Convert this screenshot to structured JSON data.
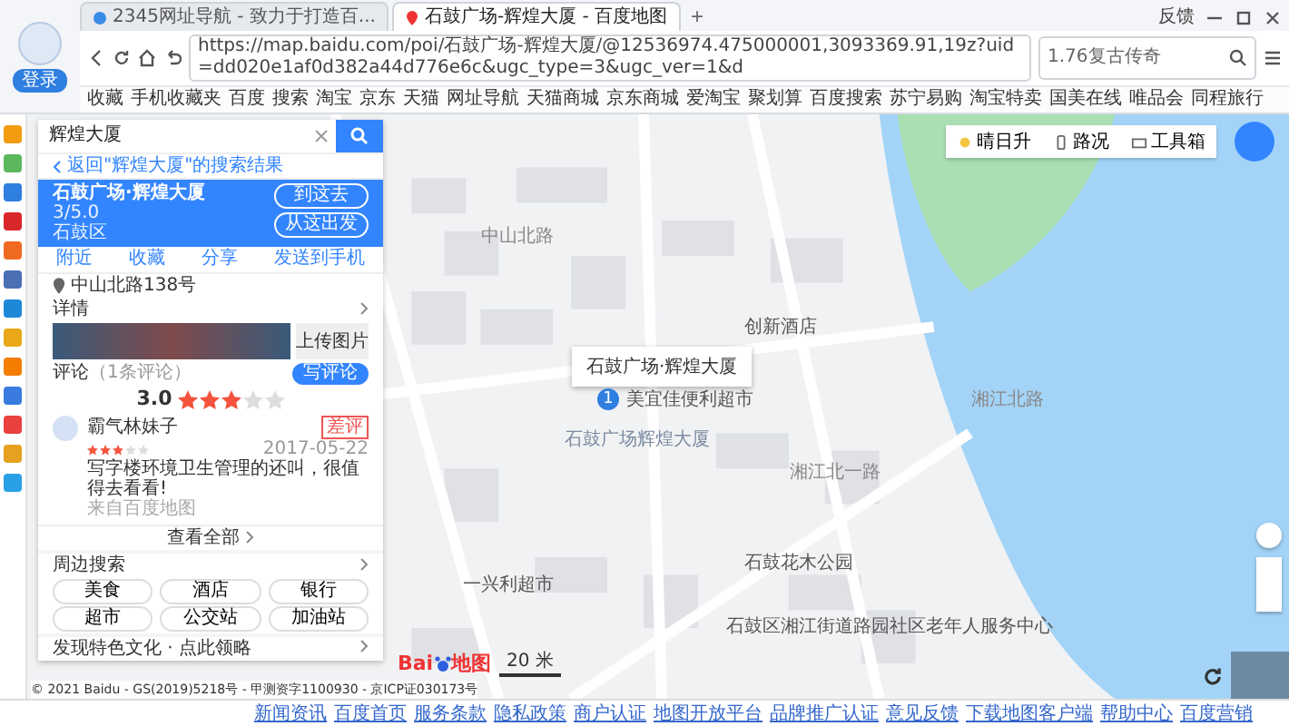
{
  "browser": {
    "login": "登录",
    "tabs": [
      {
        "title": "2345网址导航 - 致力于打造百...",
        "selected": false
      },
      {
        "title": "石鼓广场-辉煌大厦 - 百度地图",
        "selected": true
      }
    ],
    "new_tab": "+",
    "feedback": "反馈",
    "url": "https://map.baidu.com/poi/石鼓广场-辉煌大厦/@12536974.475000001,3093369.91,19z?uid=dd020e1af0d382a44d776e6c&ugc_type=3&ugc_ver=1&d",
    "search": "1.76复古传奇",
    "bookmarks": [
      "收藏",
      "手机收藏夹",
      "百度",
      "搜索",
      "淘宝",
      "京东",
      "天猫",
      "网址导航",
      "天猫商城",
      "京东商城",
      "爱淘宝",
      "聚划算",
      "百度搜索",
      "苏宁易购",
      "淘宝特卖",
      "国美在线",
      "唯品会",
      "同程旅行"
    ]
  },
  "panel": {
    "search": {
      "value": "辉煌大厦"
    },
    "back": "返回\"辉煌大厦\"的搜索结果",
    "place": {
      "name": "石鼓广场·辉煌大厦",
      "score": "3/5.0",
      "district": "石鼓区",
      "buttons": [
        "到这去",
        "从这出发"
      ]
    },
    "actions": [
      "附近",
      "收藏",
      "分享",
      "发送到手机"
    ],
    "address": "中山北路138号",
    "details": "详情",
    "upload": "上传图片",
    "comments": {
      "label": "评论",
      "count": "（1条评论）",
      "write": "写评论"
    },
    "rating": {
      "score": "3.0",
      "stars": 3
    },
    "review": {
      "user": "霸气林妹子",
      "stars": 3,
      "badge": "差评",
      "date": "2017-05-22",
      "text": "写字楼环境卫生管理的还叫，很值得去看看!",
      "source": "来自百度地图"
    },
    "view_all": "查看全部",
    "nearby": {
      "title": "周边搜索",
      "chips": [
        "美食",
        "酒店",
        "银行",
        "超市",
        "公交站",
        "加油站"
      ]
    },
    "discover": "发现特色文化 · 点此领略"
  },
  "map": {
    "controls": [
      "晴日升",
      "路况",
      "工具箱"
    ],
    "popup": "石鼓广场·辉煌大厦",
    "marker": "1",
    "labels": [
      {
        "text": "中山北路",
        "kind": "road"
      },
      {
        "text": "创新酒店",
        "kind": "poi"
      },
      {
        "text": "美宜佳便利超市",
        "kind": "poi"
      },
      {
        "text": "湘江北路",
        "kind": "road"
      },
      {
        "text": "石鼓广场辉煌大厦",
        "kind": "area"
      },
      {
        "text": "湘江北一路",
        "kind": "road"
      },
      {
        "text": "石鼓花木公园",
        "kind": "poi"
      },
      {
        "text": "一兴利超市",
        "kind": "poi"
      },
      {
        "text": "石鼓区湘江街道路园社区老年人服务中心",
        "kind": "poi"
      }
    ],
    "logo": {
      "brand": "Bai",
      "product": "地图"
    },
    "scale": "20 米"
  },
  "footer": {
    "copyright": "© 2021 Baidu - GS(2019)5218号 - 甲测资字1100930 - 京ICP证030173号",
    "links": [
      "新闻资讯",
      "百度首页",
      "服务条款",
      "隐私政策",
      "商户认证",
      "地图开放平台",
      "品牌推广认证",
      "意见反馈",
      "下载地图客户端",
      "帮助中心",
      "百度营销"
    ]
  }
}
